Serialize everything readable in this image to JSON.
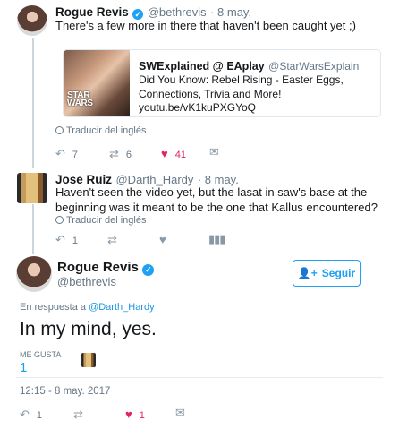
{
  "tweet1": {
    "name": "Rogue Revis",
    "handle": "@bethrevis",
    "date": "· 8 may.",
    "text": "There's a few more in there that haven't been caught yet ;)",
    "card": {
      "title": "SWExplained @ EAplay",
      "handle": "@StarWarsExplain",
      "text": "Did You Know: Rebel Rising - Easter Eggs, Connections, Trivia and More! youtu.be/vK1kuPXGYoQ",
      "image_logo": "STAR WARS"
    },
    "translate": "Traducir del inglés",
    "replies": "7",
    "retweets": "6",
    "likes": "41"
  },
  "tweet2": {
    "name": "Jose Ruiz",
    "handle": "@Darth_Hardy",
    "date": "· 8 may.",
    "text": "Haven't seen the video yet, but the lasat in saw's base at the beginning was it meant to be the one that Kallus encountered?",
    "translate": "Traducir del inglés",
    "replies": "1"
  },
  "main": {
    "name": "Rogue Revis",
    "handle": "@bethrevis",
    "follow_label": "Seguir",
    "reply_prefix": "En respuesta a",
    "reply_to": "@Darth_Hardy",
    "text": "In my mind, yes.",
    "likes_label": "ME GUSTA",
    "likes_count": "1",
    "timestamp": "12:15 - 8 may. 2017",
    "replies": "1",
    "likes": "1"
  },
  "icons": {
    "reply": "reply-icon",
    "retweet": "retweet-icon",
    "like": "heart-icon",
    "dm": "envelope-icon",
    "analytics": "analytics-icon",
    "verified": "verified-badge-icon"
  },
  "colors": {
    "accent": "#1da1f2",
    "like_red": "#e0245e",
    "muted": "#657786"
  }
}
